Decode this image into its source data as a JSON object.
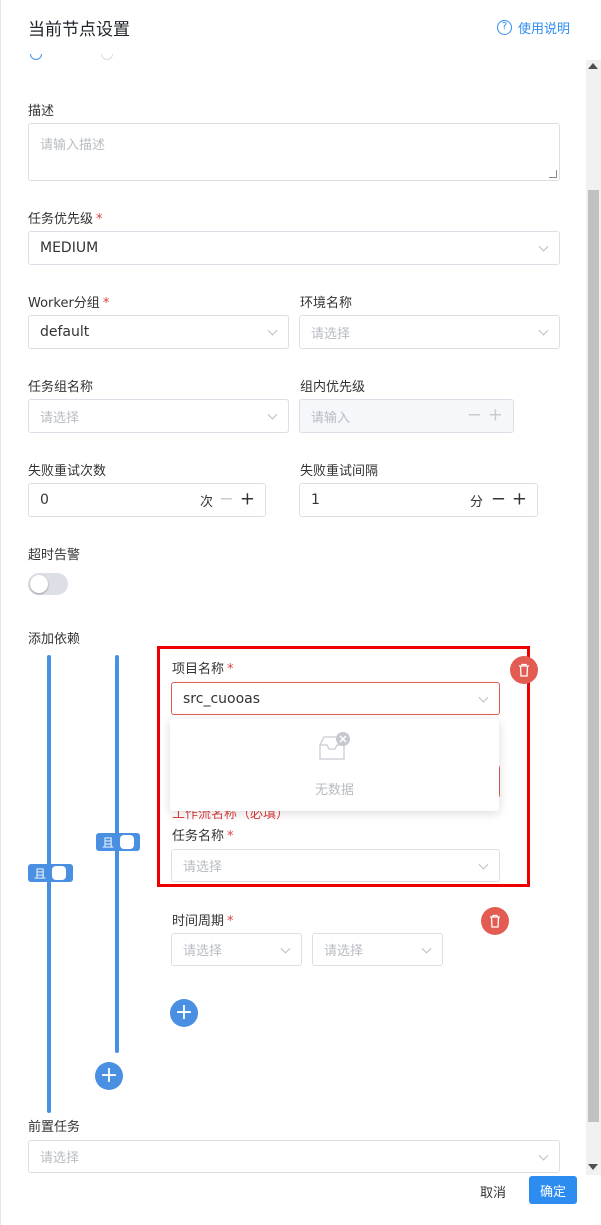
{
  "header": {
    "title": "当前节点设置",
    "help_label": "使用说明"
  },
  "form": {
    "description": {
      "label": "描述",
      "placeholder": "请输入描述"
    },
    "priority": {
      "label": "任务优先级",
      "value": "MEDIUM"
    },
    "worker_group": {
      "label": "Worker分组",
      "value": "default"
    },
    "environment": {
      "label": "环境名称",
      "placeholder": "请选择"
    },
    "task_group": {
      "label": "任务组名称",
      "placeholder": "请选择"
    },
    "group_priority": {
      "label": "组内优先级",
      "placeholder": "请输入"
    },
    "retry_times": {
      "label": "失败重试次数",
      "value": "0",
      "unit": "次"
    },
    "retry_interval": {
      "label": "失败重试间隔",
      "value": "1",
      "unit": "分"
    },
    "timeout_alarm": {
      "label": "超时告警",
      "enabled": false
    },
    "dependency": {
      "label": "添加依赖",
      "outer_relation": "且",
      "inner_relation": "且",
      "project": {
        "label": "项目名称",
        "value": "src_cuooas"
      },
      "dropdown_empty": "无数据",
      "workflow_error": "工作流名称（必填）",
      "task": {
        "label": "任务名称",
        "placeholder": "请选择"
      },
      "cycle": {
        "label": "时间周期",
        "placeholder_1": "请选择",
        "placeholder_2": "请选择"
      }
    },
    "pre_task": {
      "label": "前置任务",
      "placeholder": "请选择"
    }
  },
  "footer": {
    "cancel_label": "取消",
    "confirm_label": "确定"
  },
  "colors": {
    "accent": "#2d8cf0",
    "line": "#4a90e2",
    "danger": "#e35c52",
    "highlight": "#ee0000"
  },
  "icons": {
    "help": "question-circle-icon",
    "delete": "trash-icon",
    "add": "plus-icon",
    "empty": "empty-inbox-icon",
    "select": "chevron-down-icon"
  }
}
